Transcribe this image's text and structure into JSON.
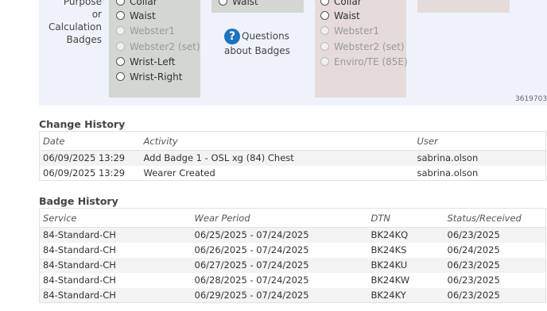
{
  "purpose": {
    "label_lines": [
      "Purpose",
      "or",
      "Calculation",
      "Badges"
    ]
  },
  "col1": {
    "options": [
      {
        "label": "Collar",
        "disabled": false
      },
      {
        "label": "Waist",
        "disabled": false
      },
      {
        "label": "Webster1",
        "disabled": true
      },
      {
        "label": "Webster2 (set)",
        "disabled": true
      },
      {
        "label": "Wrist-Left",
        "disabled": false
      },
      {
        "label": "Wrist-Right",
        "disabled": false
      }
    ]
  },
  "col2": {
    "options": [
      {
        "label": "Waist",
        "disabled": false
      }
    ]
  },
  "col3": {
    "options": [
      {
        "label": "Collar",
        "disabled": false
      },
      {
        "label": "Waist",
        "disabled": false
      },
      {
        "label": "Webster1",
        "disabled": true
      },
      {
        "label": "Webster2 (set)",
        "disabled": true
      },
      {
        "label": "Enviro/TE (85E)",
        "disabled": true
      }
    ]
  },
  "questions": {
    "icon": "question-circle-icon",
    "line1": "Questions",
    "line2": "about Badges"
  },
  "panel_id": "3619703",
  "change_history": {
    "title": "Change History",
    "columns": [
      "Date",
      "Activity",
      "User"
    ],
    "rows": [
      [
        "06/09/2025 13:29",
        "Add Badge 1 - OSL xg (84) Chest",
        "sabrina.olson"
      ],
      [
        "06/09/2025 13:29",
        "Wearer Created",
        "sabrina.olson"
      ]
    ]
  },
  "badge_history": {
    "title": "Badge History",
    "columns": [
      "Service",
      "Wear Period",
      "DTN",
      "Status/Received"
    ],
    "rows": [
      [
        "84-Standard-CH",
        "06/25/2025 - 07/24/2025",
        "BK24KQ",
        "06/23/2025"
      ],
      [
        "84-Standard-CH",
        "06/26/2025 - 07/24/2025",
        "BK24KS",
        "06/24/2025"
      ],
      [
        "84-Standard-CH",
        "06/27/2025 - 07/24/2025",
        "BK24KU",
        "06/23/2025"
      ],
      [
        "84-Standard-CH",
        "06/28/2025 - 07/24/2025",
        "BK24KW",
        "06/23/2025"
      ],
      [
        "84-Standard-CH",
        "06/29/2025 - 07/24/2025",
        "BK24KY",
        "06/23/2025"
      ]
    ]
  },
  "colors": {
    "panel_bg": "#eef3fb",
    "gray_col": "#d3d6d2",
    "pink_col": "#e5dbd8",
    "question_icon": "#1e73be"
  }
}
